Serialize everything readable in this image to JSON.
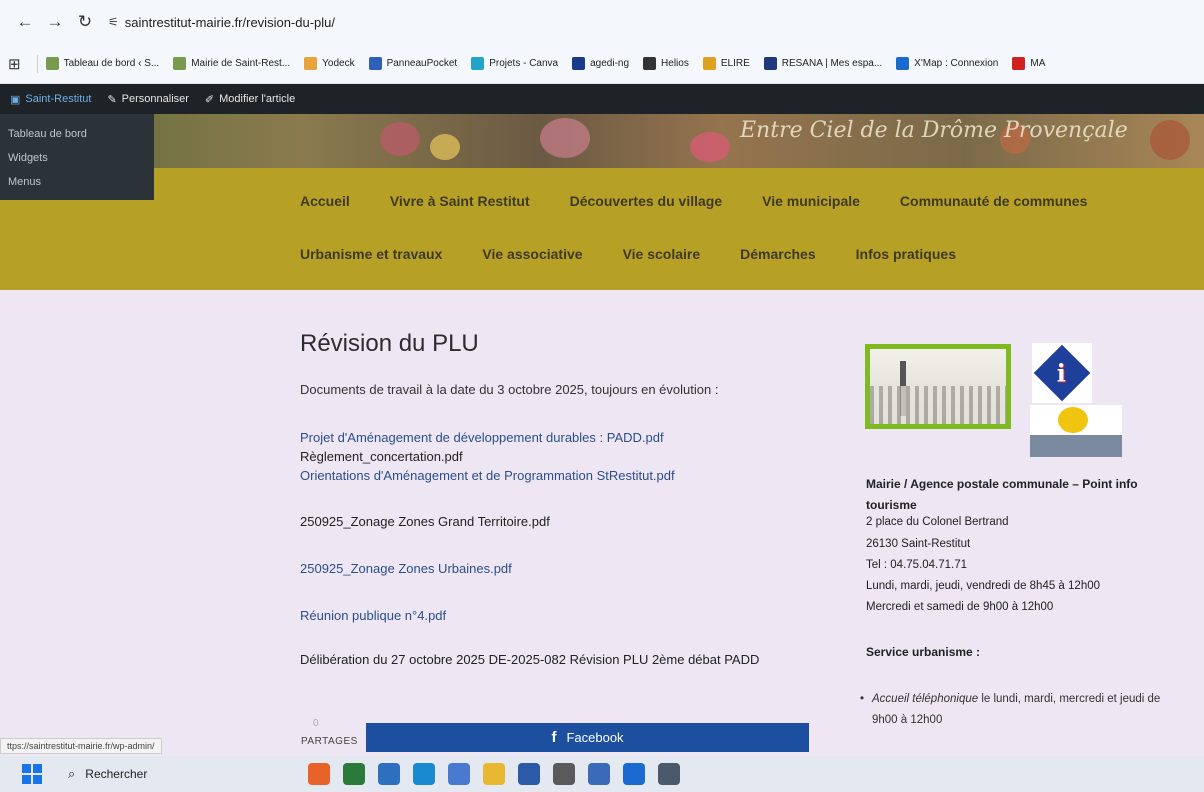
{
  "browser": {
    "url": "saintrestitut-mairie.fr/revision-du-plu/",
    "bookmarks": [
      {
        "label": "Tableau de bord ‹ S...",
        "color": "#7a9a4f"
      },
      {
        "label": "Mairie de Saint-Rest...",
        "color": "#7a9a4f"
      },
      {
        "label": "Yodeck",
        "color": "#e8a33a"
      },
      {
        "label": "PanneauPocket",
        "color": "#2f5fb8"
      },
      {
        "label": "Projets - Canva",
        "color": "#22a3c8"
      },
      {
        "label": "agedi-ng",
        "color": "#1a3b8a"
      },
      {
        "label": "Helios",
        "color": "#333333"
      },
      {
        "label": "ELIRE",
        "color": "#e0a020"
      },
      {
        "label": "RESANA | Mes espa...",
        "color": "#1f3a7a"
      },
      {
        "label": "X'Map : Connexion",
        "color": "#1a6bd0"
      },
      {
        "label": "MA",
        "color": "#d02020"
      }
    ]
  },
  "wp_admin": {
    "site_name": "Saint-Restitut",
    "customize": "Personnaliser",
    "edit_article": "Modifier l'article",
    "dropdown": [
      "Tableau de bord",
      "Widgets",
      "Menus"
    ]
  },
  "banner": {
    "script_text": "Entre Ciel de la Drôme Provençale"
  },
  "nav": {
    "row1": [
      "Accueil",
      "Vivre à Saint Restitut",
      "Découvertes du village",
      "Vie municipale",
      "Communauté de communes"
    ],
    "row2": [
      "Urbanisme et travaux",
      "Vie associative",
      "Vie scolaire",
      "Démarches",
      "Infos pratiques"
    ]
  },
  "content": {
    "title": "Révision du PLU",
    "intro": "Documents de travail à la date du 3 octobre 2025, toujours en évolution :",
    "documents": [
      {
        "label": "Projet d'Aménagement de développement durables : PADD.pdf",
        "link": true
      },
      {
        "label": "Règlement_concertation.pdf",
        "link": false
      },
      {
        "label": "Orientations d'Aménagement et de Programmation StRestitut.pdf",
        "link": true
      },
      {
        "label": "250925_Zonage Zones Grand Territoire.pdf",
        "link": false
      },
      {
        "label": "250925_Zonage Zones Urbaines.pdf",
        "link": true
      },
      {
        "label": "Réunion publique n°4.pdf",
        "link": true
      }
    ],
    "deliberation": "Délibération du 27 octobre 2025 DE-2025-082 Révision PLU 2ème débat PADD"
  },
  "share": {
    "count": "0",
    "label": "PARTAGES",
    "facebook": "Facebook"
  },
  "sidebar": {
    "title": "Mairie / Agence postale communale – Point info tourisme",
    "address1": "2 place du Colonel Bertrand",
    "address2": "26130 Saint-Restitut",
    "phone": "Tel : 04.75.04.71.71",
    "hours1": "Lundi, mardi, jeudi, vendredi de 8h45 à 12h00",
    "hours2": "Mercredi et samedi de 9h00 à 12h00",
    "service_title": "Service urbanisme :",
    "service_item_em": "Accueil téléphonique",
    "service_item_rest": " le lundi, mardi, mercredi et jeudi de 9h00 à 12h00"
  },
  "status_bar": {
    "url": "ttps://saintrestitut-mairie.fr/wp-admin/"
  },
  "taskbar": {
    "search_label": "Rechercher",
    "apps": [
      {
        "name": "firefox",
        "color": "#e8632a"
      },
      {
        "name": "excel-chart",
        "color": "#2a7a3a"
      },
      {
        "name": "files-blue",
        "color": "#2f6fc0"
      },
      {
        "name": "edge",
        "color": "#1a8ad0"
      },
      {
        "name": "feather-app",
        "color": "#4a7ad0"
      },
      {
        "name": "file-explorer",
        "color": "#e8b830"
      },
      {
        "name": "store",
        "color": "#2a5aa8"
      },
      {
        "name": "chrome",
        "color": "#5a5a5a"
      },
      {
        "name": "teams-people",
        "color": "#3a6ab8"
      },
      {
        "name": "outlook",
        "color": "#1a6ad0"
      },
      {
        "name": "calculator",
        "color": "#4a5a6a"
      }
    ]
  }
}
